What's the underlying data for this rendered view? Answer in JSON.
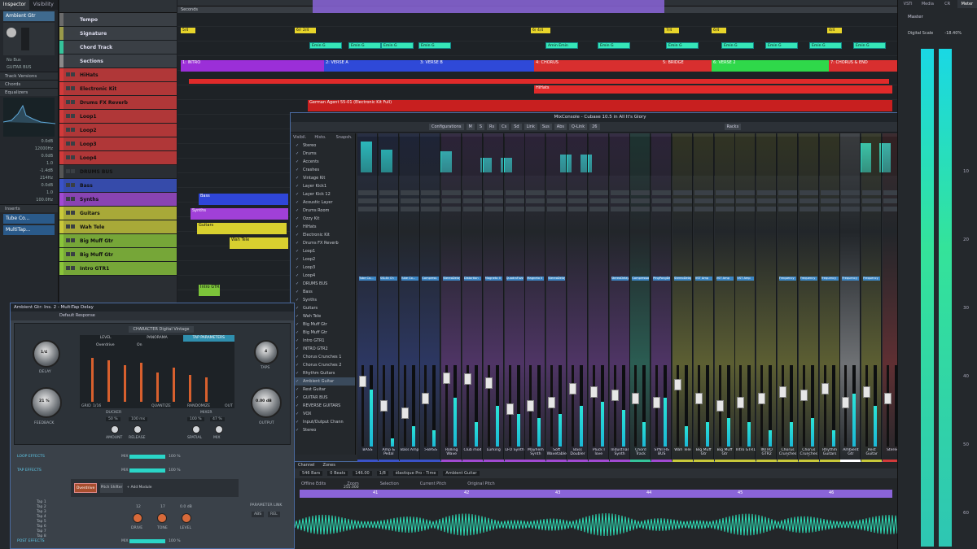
{
  "inspector": {
    "tabs": [
      "Inspector",
      "Visibility"
    ],
    "track_name": "Ambient Gtr",
    "sections": [
      "Track Versions",
      "Chords",
      "Equalizers",
      "Inserts"
    ],
    "values": [
      "0.0dB",
      "12000Hz",
      "0.0dB",
      "1.0",
      "-1.4dB",
      "214Hz",
      "0.0dB",
      "1.0",
      "100.0Hz"
    ],
    "routing": [
      "No Bus",
      "GUITAR BUS"
    ],
    "inserts": [
      "Tube Co...",
      "MultiTap..."
    ]
  },
  "tracks": [
    {
      "name": "Tempo",
      "color": "#6b6b6b"
    },
    {
      "name": "Signature",
      "color": "#9a9a4a"
    },
    {
      "name": "Chord Track",
      "color": "#35c39a"
    },
    {
      "name": "Sections",
      "color": "#8a8a8a"
    },
    {
      "name": "HiHats",
      "color": "#d23a3a"
    },
    {
      "name": "Electronic Kit",
      "color": "#d23a3a"
    },
    {
      "name": "Drums FX Reverb",
      "color": "#d23a3a"
    },
    {
      "name": "Loop1",
      "color": "#d23a3a"
    },
    {
      "name": "Loop2",
      "color": "#d23a3a"
    },
    {
      "name": "Loop3",
      "color": "#d23a3a"
    },
    {
      "name": "Loop4",
      "color": "#d23a3a"
    },
    {
      "name": "DRUMS BUS",
      "color": "#555"
    },
    {
      "name": "Bass",
      "color": "#3a52c8"
    },
    {
      "name": "Synths",
      "color": "#a14ad2"
    },
    {
      "name": "Guitars",
      "color": "#c8c83a"
    },
    {
      "name": "Wah Tele",
      "color": "#c8c83a"
    },
    {
      "name": "Big Muff Gtr",
      "color": "#8ac43a"
    },
    {
      "name": "Big Muff Gtr",
      "color": "#8ac43a"
    },
    {
      "name": "Intro GTR1",
      "color": "#8ac43a"
    }
  ],
  "arrange": {
    "ruler_label": "Seconds",
    "sections": [
      "1: INTRO",
      "2: VERSE A",
      "3: VERSE B",
      "4: CHORUS",
      "5: BRIDGE",
      "6: VERSE 2",
      "7: CHORUS & END"
    ],
    "chord_labels": [
      "Emin G",
      "Emin G",
      "Emin G",
      "Emin G",
      "Amin Emin",
      "Emin G",
      "Emin G",
      "Emin G"
    ],
    "signatures": [
      "5/4",
      "6/4",
      "2/4",
      "6/4",
      "4/4",
      "7/4",
      "6/4",
      "4/4"
    ],
    "clip_labels": {
      "hihats": "HiHats",
      "drums": "German Agent 55-01 (Electronic Kit Full)",
      "bass": "Bass",
      "synths": "Synths",
      "guitars": "Guitars",
      "wah": "Wah Tele",
      "intro": "Intro GTR"
    }
  },
  "mixconsole": {
    "title": "MixConsole - Cubase 10.5 in All It's Glory",
    "toolbar": [
      "Configurations",
      "M",
      "S",
      "Rs",
      "Cs",
      "Sd",
      "Link",
      "Sus",
      "Abs",
      "Q-Link",
      "26",
      "Racks"
    ],
    "visibility_tabs": [
      "Visibil.",
      "Histo.",
      "Snapsh."
    ],
    "visibility_items": [
      "Stereo",
      "Drums",
      "Accents",
      "Crashes",
      "Vintage Kit",
      "Layer Kick1",
      "Layer Kick 12",
      "Acoustic Layer",
      "Drums Room",
      "Ozzy Kit",
      "HiHats",
      "Electronic Kit",
      "Drums FX Reverb",
      "Loop1",
      "Loop2",
      "Loop3",
      "Loop4",
      "DRUMS BUS",
      "Bass",
      "Synths",
      "Guitars",
      "Wah Tele",
      "Big Muff Gtr",
      "Big Muff Gtr",
      "Intro GTR1",
      "INTRO GTR2",
      "Chorus Crunches 1",
      "Chorus Crunches 2",
      "Rhythm Guitars",
      "Ambient Guitar",
      "Rest Guitar",
      "GUITAR BUS",
      "REVERSE GUITARS",
      "VOX",
      "Input/Output Chann",
      "Stereo"
    ],
    "strips": [
      {
        "name": "BASS",
        "color": "#3a52c8",
        "fader": 0.85,
        "level": 0.7,
        "insert": "Tube Co..."
      },
      {
        "name": "Amp & Pedal",
        "color": "#3a52c8",
        "fader": 0.5,
        "level": 0.1,
        "insert": "SSL4k Ch"
      },
      {
        "name": "Bass Amp",
        "color": "#3a52c8",
        "fader": 0.4,
        "level": 0.25,
        "insert": "Tube Co..."
      },
      {
        "name": ">BASS",
        "color": "#3a52c8",
        "fader": 0.6,
        "level": 0.2,
        "insert": "Compress"
      },
      {
        "name": "Rolling Wave",
        "color": "#a14ad2",
        "fader": 0.9,
        "level": 0.6,
        "insert": "StereoDelay"
      },
      {
        "name": "Club mod",
        "color": "#a14ad2",
        "fader": 0.88,
        "level": 0.3,
        "insert": "Distortion"
      },
      {
        "name": "Lurking",
        "color": "#a14ad2",
        "fader": 0.82,
        "level": 0.5,
        "insert": "Magneto II"
      },
      {
        "name": "LFO Synth",
        "color": "#a14ad2",
        "fader": 0.45,
        "level": 0.4,
        "insert": "QuadraFuzz"
      },
      {
        "name": "Mayhem Synth",
        "color": "#a14ad2",
        "fader": 0.5,
        "level": 0.35,
        "insert": "Magneto II"
      },
      {
        "name": "Soft Wavetable",
        "color": "#a14ad2",
        "fader": 0.55,
        "level": 0.4,
        "insert": "StereoDelay"
      },
      {
        "name": "Bass Doubler",
        "color": "#a14ad2",
        "fader": 0.75,
        "level": 0.5,
        "insert": ""
      },
      {
        "name": "Pluck I love",
        "color": "#a14ad2",
        "fader": 0.7,
        "level": 0.55,
        "insert": ""
      },
      {
        "name": "Industrial Synth",
        "color": "#a14ad2",
        "fader": 0.65,
        "level": 0.45,
        "insert": "StereoDelay"
      },
      {
        "name": "Chord Track",
        "color": "#35c39a",
        "fader": 0.6,
        "level": 0.3,
        "insert": "Compressor"
      },
      {
        "name": "SYNTHS BUS",
        "color": "#a14ad2",
        "fader": 0.55,
        "level": 0.6,
        "insert": "PingPongDel"
      },
      {
        "name": "Wah Tele",
        "color": "#c8c83a",
        "fader": 0.8,
        "level": 0.25,
        "insert": "StereoDelay"
      },
      {
        "name": "Big Muff Gtr",
        "color": "#c8c83a",
        "fader": 0.6,
        "level": 0.3,
        "insert": "VST Amp"
      },
      {
        "name": "Big Muff Gtr",
        "color": "#c8c83a",
        "fader": 0.5,
        "level": 0.35,
        "insert": "VST Amp"
      },
      {
        "name": "Intro GTR1",
        "color": "#c8c83a",
        "fader": 0.55,
        "level": 0.3,
        "insert": "VST Amp"
      },
      {
        "name": "INTRO GTR2",
        "color": "#c8c83a",
        "fader": 0.6,
        "level": 0.2,
        "insert": ""
      },
      {
        "name": "Chorus Crunches 1",
        "color": "#c8c83a",
        "fader": 0.7,
        "level": 0.3,
        "insert": "Frequency"
      },
      {
        "name": "Chorus Crunches 2",
        "color": "#c8c83a",
        "fader": 0.65,
        "level": 0.35,
        "insert": "Frequency"
      },
      {
        "name": "Rhythm Guitars",
        "color": "#c8c83a",
        "fader": 0.75,
        "level": 0.2,
        "insert": "Frequency"
      },
      {
        "name": "Ambient Gtr",
        "color": "#ffffff",
        "fader": 0.55,
        "level": 0.65,
        "insert": "Frequency"
      },
      {
        "name": "Rest Guitar",
        "color": "#c8c83a",
        "fader": 0.7,
        "level": 0.5,
        "insert": "Frequency"
      },
      {
        "name": "Stereo",
        "color": "#d23a3a",
        "fader": 0.6,
        "level": 0.0,
        "insert": ""
      }
    ]
  },
  "lowerzone": {
    "tabs": [
      "Channel",
      "Zones"
    ],
    "toolbar": [
      "546 Bars",
      "0 Beats",
      "146.00",
      "1/8",
      "élastique Pro - Time",
      "Ambient Guitar"
    ],
    "info_labels": [
      "Offline Edits",
      "Zoom",
      "Selection",
      "Current Pitch",
      "Original Pitch"
    ],
    "zoom_value": "255.000",
    "ruler_marks": [
      "41",
      "42",
      "43",
      "44",
      "45",
      "46"
    ]
  },
  "plugin": {
    "title": "Ambient Gtr: Ins. 2 - MultiTap Delay",
    "preset": "Default Response",
    "character": "Digital Vintage",
    "tabs": [
      "LEVEL",
      "PANORAMA",
      "TAP PARAMETERS"
    ],
    "mode": "Overdrive",
    "overdrive_value": "On",
    "knobs": {
      "delay": "DELAY",
      "delay_value": "1/4",
      "feedback": "FEEDBACK",
      "feedback_value": "21 %",
      "taps": "TAPS",
      "taps_value": "4",
      "output": "OUTPUT",
      "output_value": "0.00 dB"
    },
    "ducker": {
      "label": "DUCKER",
      "amount": "50 %",
      "release": "100 ms",
      "amount_label": "AMOUNT",
      "release_label": "RELEASE"
    },
    "mixer": {
      "label": "MIXER",
      "spatial": "100 %",
      "mix": "47 %",
      "spatial_label": "SPATIAL",
      "mix_label": "MIX"
    },
    "grid_labels": [
      "GRID",
      "1/16",
      "QUANTIZE",
      "RANDOMIZE",
      "OUT"
    ],
    "sections": [
      "LOOP EFFECTS",
      "TAP EFFECTS",
      "POST EFFECTS"
    ],
    "slider_values": [
      "100 %",
      "100 %",
      "100 %"
    ],
    "mix_label": "MIX",
    "fx_chain": [
      "Overdrive",
      "Pitch Shifter",
      "+ Add Module"
    ],
    "taps": [
      "Tap 1",
      "Tap 2",
      "Tap 3",
      "Tap 4",
      "Tap 5",
      "Tap 6",
      "Tap 7",
      "Tap 8"
    ],
    "fx_knobs": [
      "DRIVE",
      "TONE",
      "LEVEL"
    ],
    "fx_values": [
      "12",
      "17",
      "0.0 dB"
    ],
    "param_link": "PARAMETER LINK",
    "link_buttons": [
      "ABS",
      "REL"
    ]
  },
  "rightpanel": {
    "tabs": [
      "VSTi",
      "Media",
      "CR",
      "Meter"
    ],
    "master": "Master",
    "scale_label": "Digital Scale",
    "scale_value": "-18.40%",
    "scale": [
      "10",
      "20",
      "30",
      "40",
      "50",
      "60"
    ]
  }
}
